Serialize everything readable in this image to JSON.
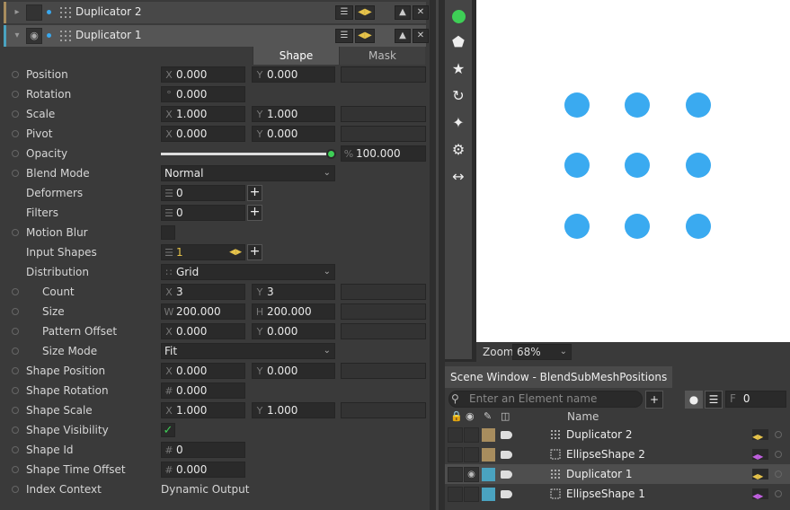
{
  "colors": {
    "accent_blue": "#3aaaf0",
    "green": "#3ecf56",
    "swatch_tan": "#a88d5e",
    "swatch_teal": "#4aa3c0",
    "stripe_dup2": "#a88d5e",
    "stripe_dup1": "#4aa3c0"
  },
  "layers": [
    {
      "title": "Duplicator 2",
      "icon": "grid-dots-icon"
    },
    {
      "title": "Duplicator 1",
      "icon": "grid-dots-icon"
    }
  ],
  "tabs": [
    {
      "label": "Shape",
      "selected": true
    },
    {
      "label": "Mask",
      "selected": false
    }
  ],
  "props": {
    "position": {
      "label": "Position",
      "x": "0.000",
      "y": "0.000"
    },
    "rotation": {
      "label": "Rotation",
      "prefix": "°",
      "value": "0.000"
    },
    "scale": {
      "label": "Scale",
      "x": "1.000",
      "y": "1.000"
    },
    "pivot": {
      "label": "Pivot",
      "x": "0.000",
      "y": "0.000"
    },
    "opacity": {
      "label": "Opacity",
      "prefix": "%",
      "value": "100.000",
      "level": 1.0
    },
    "blend_mode": {
      "label": "Blend Mode",
      "value": "Normal"
    },
    "deformers": {
      "label": "Deformers",
      "value": "0"
    },
    "filters": {
      "label": "Filters",
      "value": "0"
    },
    "motion_blur": {
      "label": "Motion Blur"
    },
    "input_shapes": {
      "label": "Input Shapes",
      "value": "1"
    },
    "distribution": {
      "label": "Distribution",
      "value": "Grid"
    },
    "count": {
      "label": "Count",
      "x": "3",
      "y": "3"
    },
    "size": {
      "label": "Size",
      "w_prefix": "W",
      "h_prefix": "H",
      "w": "200.000",
      "h": "200.000"
    },
    "pattern_offset": {
      "label": "Pattern Offset",
      "x": "0.000",
      "y": "0.000"
    },
    "size_mode": {
      "label": "Size Mode",
      "value": "Fit"
    },
    "shape_position": {
      "label": "Shape Position",
      "x": "0.000",
      "y": "0.000"
    },
    "shape_rotation": {
      "label": "Shape Rotation",
      "prefix": "#",
      "value": "0.000"
    },
    "shape_scale": {
      "label": "Shape Scale",
      "x": "1.000",
      "y": "1.000"
    },
    "shape_visibility": {
      "label": "Shape Visibility",
      "checked": true
    },
    "shape_id": {
      "label": "Shape Id",
      "prefix": "#",
      "value": "0"
    },
    "shape_time_offset": {
      "label": "Shape Time Offset",
      "prefix": "#",
      "value": "0.000"
    },
    "index_context": {
      "label": "Index Context",
      "value": "Dynamic Output"
    }
  },
  "axis": {
    "x": "X",
    "y": "Y"
  },
  "toolbar": [
    "ellipse-tool-icon",
    "polygon-tool-icon",
    "star-tool-icon",
    "arc-tool-icon",
    "sparkle-tool-icon",
    "gear-tool-icon",
    "resize-tool-icon"
  ],
  "viewport": {
    "grid_rows": 3,
    "grid_cols": 3
  },
  "zoom": {
    "label": "Zoom",
    "value": "68%"
  },
  "scene": {
    "title": "Scene Window - BlendSubMeshPositions",
    "search_placeholder": "Enter an Element name",
    "frame_prefix": "F",
    "frame_value": "0",
    "name_header": "Name",
    "rows": [
      {
        "name": "Duplicator 2",
        "type": "duplicator",
        "swatch": "#a88d5e",
        "selected": false,
        "visible": false
      },
      {
        "name": "EllipseShape 2",
        "type": "ellipse",
        "swatch": "#a88d5e",
        "selected": false,
        "visible": false
      },
      {
        "name": "Duplicator 1",
        "type": "duplicator",
        "swatch": "#4aa3c0",
        "selected": true,
        "visible": true
      },
      {
        "name": "EllipseShape 1",
        "type": "ellipse",
        "swatch": "#4aa3c0",
        "selected": false,
        "visible": false
      }
    ]
  }
}
